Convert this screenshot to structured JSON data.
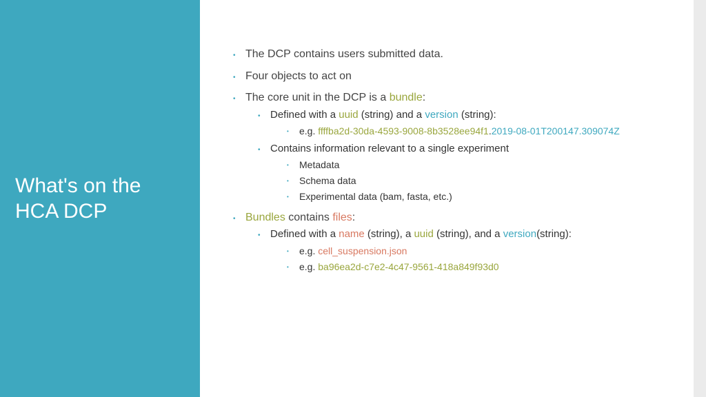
{
  "sidebar": {
    "title": "What's on the HCA DCP"
  },
  "content": {
    "b1": "The DCP contains users submitted data.",
    "b2": "Four objects to act on",
    "b3_pre": "The core unit in the DCP is a ",
    "b3_bundle": "bundle",
    "b3_post": ":",
    "b3a_pre": "Defined with a ",
    "b3a_uuid": "uuid",
    "b3a_mid": " (string) and a ",
    "b3a_ver": "version",
    "b3a_post": " (string):",
    "b3a_eg_pre": "e.g. ",
    "b3a_eg_uuid": "ffffba2d-30da-4593-9008-8b3528ee94f1",
    "b3a_eg_ver": "2019-08-01T200147.309074Z",
    "b3b": "Contains information relevant to a single experiment",
    "b3b_i": "Metadata",
    "b3b_ii": "Schema data",
    "b3b_iii": "Experimental data (bam, fasta, etc.)",
    "b4_bundles": "Bundles",
    "b4_mid": " contains ",
    "b4_files": "files",
    "b4_post": ":",
    "b4a_pre": "Defined with a ",
    "b4a_name": "name",
    "b4a_mid1": " (string), a ",
    "b4a_uuid": "uuid",
    "b4a_mid2": " (string), and a ",
    "b4a_ver": "version",
    "b4a_post": "(string):",
    "b4a_eg1_pre": "e.g. ",
    "b4a_eg1": "cell_suspension.json",
    "b4a_eg2_pre": "e.g. ",
    "b4a_eg2": "ba96ea2d-c7e2-4c47-9561-418a849f93d0"
  }
}
